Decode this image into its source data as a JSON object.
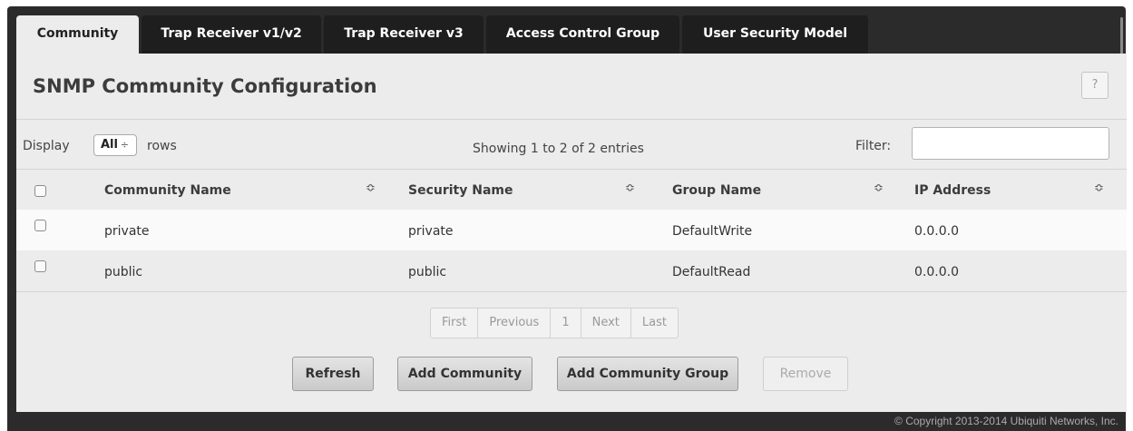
{
  "tabs": [
    {
      "label": "Community",
      "active": true
    },
    {
      "label": "Trap Receiver v1/v2",
      "active": false
    },
    {
      "label": "Trap Receiver v3",
      "active": false
    },
    {
      "label": "Access Control Group",
      "active": false
    },
    {
      "label": "User Security Model",
      "active": false
    }
  ],
  "page": {
    "title": "SNMP Community Configuration",
    "help_label": "?"
  },
  "controls": {
    "display_label": "Display",
    "display_value": "All",
    "display_arrows": "÷",
    "rows_label": "rows",
    "info": "Showing 1 to 2 of 2 entries",
    "filter_label": "Filter:",
    "filter_value": ""
  },
  "table": {
    "sort_icon": "≎",
    "columns": [
      "Community Name",
      "Security Name",
      "Group Name",
      "IP Address"
    ],
    "rows": [
      {
        "community": "private",
        "security": "private",
        "group": "DefaultWrite",
        "ip": "0.0.0.0"
      },
      {
        "community": "public",
        "security": "public",
        "group": "DefaultRead",
        "ip": "0.0.0.0"
      }
    ]
  },
  "pagination": [
    "First",
    "Previous",
    "1",
    "Next",
    "Last"
  ],
  "buttons": {
    "refresh": "Refresh",
    "add_community": "Add Community",
    "add_community_group": "Add Community Group",
    "remove": "Remove"
  },
  "footer": {
    "copyright": "© Copyright 2013-2014 Ubiquiti Networks, Inc."
  },
  "colors": {
    "panel": "#ececec",
    "frame": "#2b2b2b",
    "row_highlight": "#fafafa"
  }
}
